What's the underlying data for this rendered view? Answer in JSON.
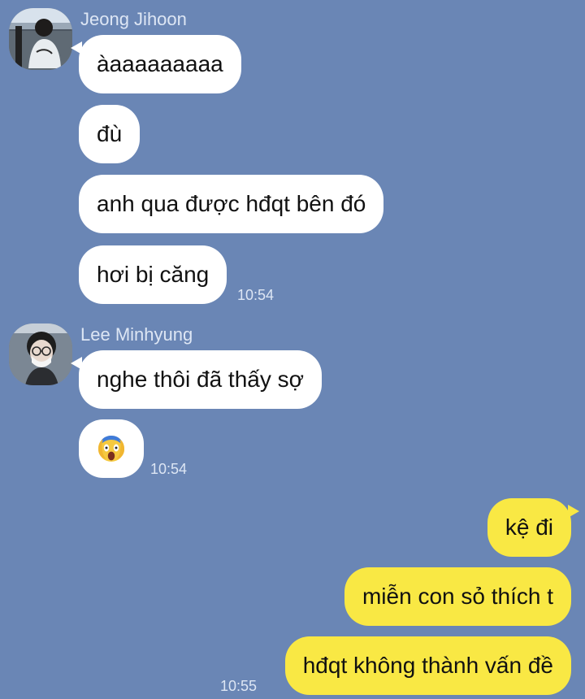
{
  "chat": {
    "groups": [
      {
        "sender": "Jeong Jihoon",
        "messages": [
          "àaaaaaaaaa",
          "đù",
          "anh qua được hđqt bên đó",
          "hơi bị căng"
        ],
        "time": "10:54"
      },
      {
        "sender": "Lee Minhyung",
        "messages": [
          "nghe thôi đã thấy sợ"
        ],
        "emoji": "screaming-face",
        "time": "10:54"
      },
      {
        "messages": [
          "kệ đi",
          "miễn con sỏ thích t",
          "hđqt không thành vấn đề"
        ],
        "time": "10:55"
      }
    ]
  },
  "colors": {
    "background": "#6a86b5",
    "incoming_bubble": "#ffffff",
    "outgoing_bubble": "#f9e844",
    "meta_text": "#dde6f4",
    "message_text": "#111111"
  },
  "icons": {
    "avatar_1": "profile-photo-avatar",
    "avatar_2": "profile-photo-avatar",
    "emoji": "screaming-face-icon"
  }
}
